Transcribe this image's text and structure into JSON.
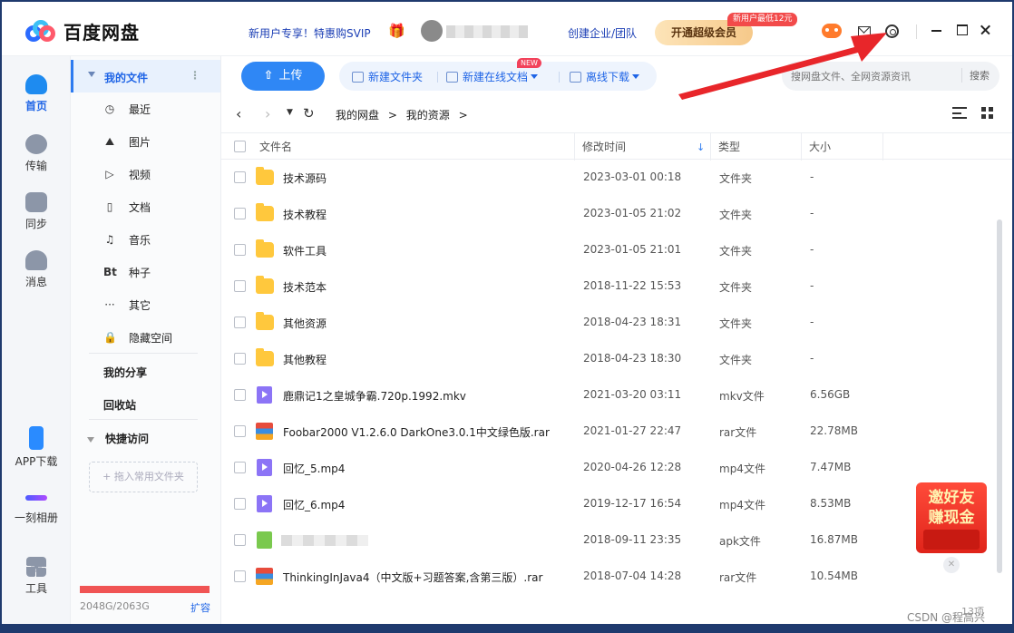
{
  "app": {
    "title": "百度网盘"
  },
  "header": {
    "promo": "新用户专享！特惠购SVIP",
    "enterprise": "创建企业/团队",
    "vip_button": "开通超级会员",
    "vip_badge": "新用户最低12元"
  },
  "rail": {
    "items": [
      {
        "label": "首页",
        "icon": "home-icon"
      },
      {
        "label": "传输",
        "icon": "transfer-icon"
      },
      {
        "label": "同步",
        "icon": "sync-icon"
      },
      {
        "label": "消息",
        "icon": "message-icon"
      },
      {
        "label": "APP下载",
        "icon": "phone-icon"
      },
      {
        "label": "一刻相册",
        "icon": "album-icon"
      },
      {
        "label": "工具",
        "icon": "tools-icon"
      }
    ]
  },
  "nav": {
    "my_files": "我的文件",
    "items": [
      {
        "label": "最近",
        "icon": "◷"
      },
      {
        "label": "图片",
        "icon": "⛰"
      },
      {
        "label": "视频",
        "icon": "▷"
      },
      {
        "label": "文档",
        "icon": "▯"
      },
      {
        "label": "音乐",
        "icon": "♫"
      },
      {
        "label": "种子",
        "icon": "Bt"
      },
      {
        "label": "其它",
        "icon": "···"
      },
      {
        "label": "隐藏空间",
        "icon": "🔒"
      }
    ],
    "my_share": "我的分享",
    "recycle": "回收站",
    "quick_access": "快捷访问",
    "drag_hint": "+ 拖入常用文件夹",
    "storage_text": "2048G/2063G",
    "storage_fraction": 0.993,
    "expand": "扩容"
  },
  "toolbar": {
    "upload": "上传",
    "new_folder": "新建文件夹",
    "new_doc": "新建在线文档",
    "new_badge": "NEW",
    "offline": "离线下载",
    "search_placeholder": "搜网盘文件、全网资源资讯",
    "search_button": "搜索"
  },
  "breadcrumb": [
    "我的网盘",
    ">",
    "我的资源",
    ">"
  ],
  "table": {
    "headers": [
      "文件名",
      "修改时间",
      "类型",
      "大小"
    ],
    "rows": [
      {
        "name": "技术源码",
        "date": "2023-03-01 00:18",
        "type": "文件夹",
        "size": "-",
        "kind": "folder"
      },
      {
        "name": "技术教程",
        "date": "2023-01-05 21:02",
        "type": "文件夹",
        "size": "-",
        "kind": "folder"
      },
      {
        "name": "软件工具",
        "date": "2023-01-05 21:01",
        "type": "文件夹",
        "size": "-",
        "kind": "folder"
      },
      {
        "name": "技术范本",
        "date": "2018-11-22 15:53",
        "type": "文件夹",
        "size": "-",
        "kind": "folder"
      },
      {
        "name": "其他资源",
        "date": "2018-04-23 18:31",
        "type": "文件夹",
        "size": "-",
        "kind": "folder"
      },
      {
        "name": "其他教程",
        "date": "2018-04-23 18:30",
        "type": "文件夹",
        "size": "-",
        "kind": "folder"
      },
      {
        "name": "鹿鼎记1之皇城争霸.720p.1992.mkv",
        "date": "2021-03-20 03:11",
        "type": "mkv文件",
        "size": "6.56GB",
        "kind": "video"
      },
      {
        "name": "Foobar2000 V1.2.6.0 DarkOne3.0.1中文绿色版.rar",
        "date": "2021-01-27 22:47",
        "type": "rar文件",
        "size": "22.78MB",
        "kind": "rar"
      },
      {
        "name": "回忆_5.mp4",
        "date": "2020-04-26 12:28",
        "type": "mp4文件",
        "size": "7.47MB",
        "kind": "video"
      },
      {
        "name": "回忆_6.mp4",
        "date": "2019-12-17 16:54",
        "type": "mp4文件",
        "size": "8.53MB",
        "kind": "video"
      },
      {
        "name": "",
        "date": "2018-09-11 23:35",
        "type": "apk文件",
        "size": "16.87MB",
        "kind": "apk"
      },
      {
        "name": "ThinkingInJava4（中文版+习题答案,含第三版）.rar",
        "date": "2018-07-04 14:28",
        "type": "rar文件",
        "size": "10.54MB",
        "kind": "rar"
      }
    ],
    "count": "13项"
  },
  "invite": {
    "line1": "邀好友",
    "line2": "赚现金"
  },
  "watermark": "CSDN @程高兴",
  "colors": {
    "accent": "#2f87f5",
    "annotation_arrow": "#e8262a"
  }
}
